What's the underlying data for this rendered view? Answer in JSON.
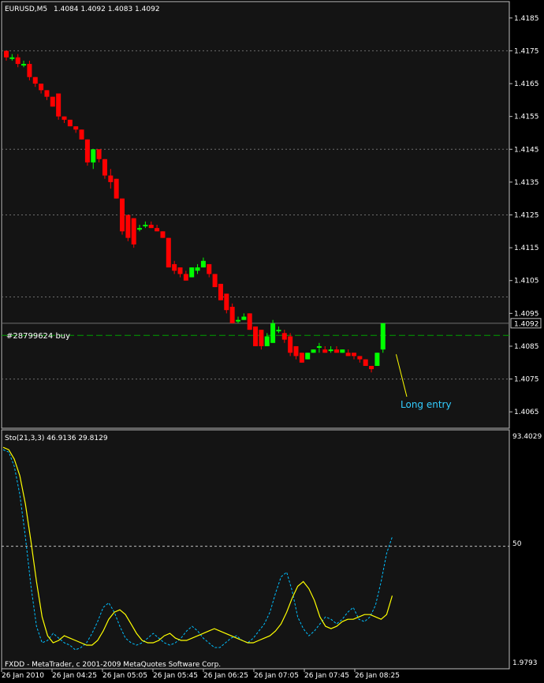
{
  "colors": {
    "background": "#000000",
    "panel_bg": "#141414",
    "frame": "#c0c0c0",
    "text": "#ffffff",
    "bull": "#00ff00",
    "bear": "#ff0000",
    "bull_wick": "#00ff00",
    "bear_wick": "#ff0000",
    "grid": "#6e6e6e",
    "order_line": "#00a000",
    "annotation": "#33ccff",
    "stoch_main": "#ffff00",
    "stoch_signal": "#00bfff",
    "level_line": "#c0c0c0"
  },
  "header": {
    "symbol": "EURUSD,M5",
    "ohlc": "1.4084 1.4092 1.4083 1.4092"
  },
  "chart_data": [
    {
      "type": "candlestick",
      "ylim": [
        1.406,
        1.419
      ],
      "y_ticks": [
        "1.4185",
        "1.4175",
        "1.4165",
        "1.4155",
        "1.4145",
        "1.4135",
        "1.4125",
        "1.4115",
        "1.4105",
        "1.4095",
        "1.4085",
        "1.4075",
        "1.4065"
      ],
      "grid_levels": [
        1.4175,
        1.4145,
        1.4125,
        1.41,
        1.4075
      ],
      "current_price": "1.4092",
      "current_price_value": 1.4092,
      "order": {
        "label": "#28799624 buy",
        "price": 1.40883
      },
      "annotation": {
        "text": "Long entry",
        "candle_index": 67
      },
      "candles": [
        [
          1.4175,
          1.4175,
          1.4172,
          1.4173
        ],
        [
          1.4173,
          1.4174,
          1.4172,
          1.4173
        ],
        [
          1.4173,
          1.4174,
          1.417,
          1.4171
        ],
        [
          1.4171,
          1.4172,
          1.417,
          1.4171
        ],
        [
          1.4171,
          1.4172,
          1.4166,
          1.4167
        ],
        [
          1.4167,
          1.4167,
          1.4164,
          1.4165
        ],
        [
          1.4165,
          1.4165,
          1.4162,
          1.4163
        ],
        [
          1.4163,
          1.4163,
          1.416,
          1.4161
        ],
        [
          1.4161,
          1.4161,
          1.4158,
          1.4158
        ],
        [
          1.4162,
          1.4162,
          1.4154,
          1.4155
        ],
        [
          1.4155,
          1.4155,
          1.4153,
          1.4154
        ],
        [
          1.4154,
          1.4154,
          1.4152,
          1.4152
        ],
        [
          1.4152,
          1.4152,
          1.415,
          1.4151
        ],
        [
          1.4151,
          1.4151,
          1.4148,
          1.4148
        ],
        [
          1.4148,
          1.4148,
          1.414,
          1.4141
        ],
        [
          1.4141,
          1.4145,
          1.4139,
          1.4145
        ],
        [
          1.4145,
          1.4145,
          1.4141,
          1.4142
        ],
        [
          1.4142,
          1.4142,
          1.4136,
          1.4137
        ],
        [
          1.4137,
          1.4139,
          1.4133,
          1.4135
        ],
        [
          1.4136,
          1.4136,
          1.413,
          1.413
        ],
        [
          1.413,
          1.413,
          1.4119,
          1.412
        ],
        [
          1.4125,
          1.4125,
          1.4117,
          1.4118
        ],
        [
          1.4124,
          1.4124,
          1.4115,
          1.4116
        ],
        [
          1.4121,
          1.4122,
          1.412,
          1.4121
        ],
        [
          1.4122,
          1.4123,
          1.4121,
          1.4122
        ],
        [
          1.4122,
          1.4123,
          1.4121,
          1.4121
        ],
        [
          1.4121,
          1.4122,
          1.412,
          1.412
        ],
        [
          1.412,
          1.412,
          1.4118,
          1.4118
        ],
        [
          1.4118,
          1.4118,
          1.4109,
          1.4109
        ],
        [
          1.411,
          1.4111,
          1.4107,
          1.4108
        ],
        [
          1.4109,
          1.4109,
          1.4106,
          1.4107
        ],
        [
          1.4107,
          1.4108,
          1.4105,
          1.4105
        ],
        [
          1.4106,
          1.4109,
          1.4106,
          1.4109
        ],
        [
          1.4108,
          1.411,
          1.4107,
          1.4109
        ],
        [
          1.4109,
          1.4112,
          1.4109,
          1.4111
        ],
        [
          1.411,
          1.411,
          1.4106,
          1.4107
        ],
        [
          1.4107,
          1.4107,
          1.4103,
          1.4103
        ],
        [
          1.4104,
          1.4104,
          1.4099,
          1.4099
        ],
        [
          1.4101,
          1.4101,
          1.4095,
          1.4096
        ],
        [
          1.4097,
          1.4098,
          1.4092,
          1.4092
        ],
        [
          1.4093,
          1.4094,
          1.4092,
          1.4093
        ],
        [
          1.4093,
          1.4095,
          1.4093,
          1.4094
        ],
        [
          1.4095,
          1.4095,
          1.409,
          1.409
        ],
        [
          1.4091,
          1.4091,
          1.4085,
          1.4085
        ],
        [
          1.409,
          1.409,
          1.4084,
          1.4085
        ],
        [
          1.4085,
          1.4089,
          1.4085,
          1.4088
        ],
        [
          1.4086,
          1.4093,
          1.4086,
          1.4092
        ],
        [
          1.409,
          1.4091,
          1.4089,
          1.409
        ],
        [
          1.4089,
          1.409,
          1.4086,
          1.4087
        ],
        [
          1.4088,
          1.4089,
          1.4082,
          1.4083
        ],
        [
          1.4085,
          1.4085,
          1.4081,
          1.4082
        ],
        [
          1.4083,
          1.4083,
          1.408,
          1.408
        ],
        [
          1.4081,
          1.4083,
          1.4081,
          1.4083
        ],
        [
          1.4083,
          1.4084,
          1.4083,
          1.4084
        ],
        [
          1.4085,
          1.4086,
          1.4083,
          1.4085
        ],
        [
          1.4084,
          1.4085,
          1.4083,
          1.4083
        ],
        [
          1.4084,
          1.4085,
          1.4083,
          1.4084
        ],
        [
          1.4084,
          1.4085,
          1.4083,
          1.4083
        ],
        [
          1.4083,
          1.4084,
          1.4083,
          1.4084
        ],
        [
          1.4083,
          1.4084,
          1.4082,
          1.4082
        ],
        [
          1.4083,
          1.4083,
          1.4081,
          1.4082
        ],
        [
          1.4082,
          1.4082,
          1.408,
          1.4081
        ],
        [
          1.4081,
          1.4081,
          1.4079,
          1.4079
        ],
        [
          1.4079,
          1.4079,
          1.4077,
          1.4078
        ],
        [
          1.4079,
          1.4083,
          1.4079,
          1.4083
        ],
        [
          1.4084,
          1.4092,
          1.4083,
          1.4092
        ]
      ]
    },
    {
      "type": "line",
      "label": "Sto(21,3,3) 46.9136 29.8129",
      "ylim": [
        1.9793,
        93.4029
      ],
      "y_tick_labels": [
        "93.4029",
        "50",
        "1.9793"
      ],
      "level": 50,
      "series": [
        {
          "color": "#ffff00",
          "values": [
            92,
            91,
            87,
            80,
            68,
            52,
            35,
            20,
            12,
            9,
            10,
            12,
            11,
            10,
            9,
            8,
            8,
            10,
            14,
            19,
            22,
            23,
            21,
            17,
            13,
            10,
            9,
            9,
            10,
            12,
            13,
            11,
            10,
            10,
            11,
            12,
            13,
            14,
            15,
            14,
            13,
            12,
            11,
            10,
            9,
            9,
            10,
            11,
            12,
            14,
            17,
            22,
            28,
            33,
            35,
            32,
            27,
            20,
            16,
            15,
            16,
            18,
            19,
            19,
            20,
            21,
            21,
            20,
            19,
            21,
            29
          ]
        },
        {
          "color": "#00bfff",
          "dashed": true,
          "values": [
            91,
            90,
            84,
            72,
            54,
            33,
            16,
            9,
            10,
            13,
            11,
            9,
            8,
            6,
            7,
            9,
            13,
            18,
            24,
            26,
            22,
            16,
            11,
            9,
            8,
            9,
            11,
            13,
            11,
            9,
            8,
            9,
            11,
            14,
            16,
            14,
            11,
            9,
            7,
            7,
            9,
            11,
            12,
            10,
            9,
            11,
            14,
            17,
            22,
            30,
            37,
            39,
            31,
            20,
            15,
            12,
            14,
            17,
            20,
            19,
            17,
            19,
            22,
            24,
            19,
            18,
            20,
            25,
            35,
            47,
            54
          ]
        }
      ]
    }
  ],
  "x_axis": {
    "labels": [
      "26 Jan 2010",
      "26 Jan 04:25",
      "26 Jan 05:05",
      "26 Jan 05:45",
      "26 Jan 06:25",
      "26 Jan 07:05",
      "26 Jan 07:45",
      "26 Jan 08:25"
    ]
  },
  "footer": {
    "copyright": "FXDD - MetaTrader, c 2001-2009 MetaQuotes Software Corp."
  }
}
